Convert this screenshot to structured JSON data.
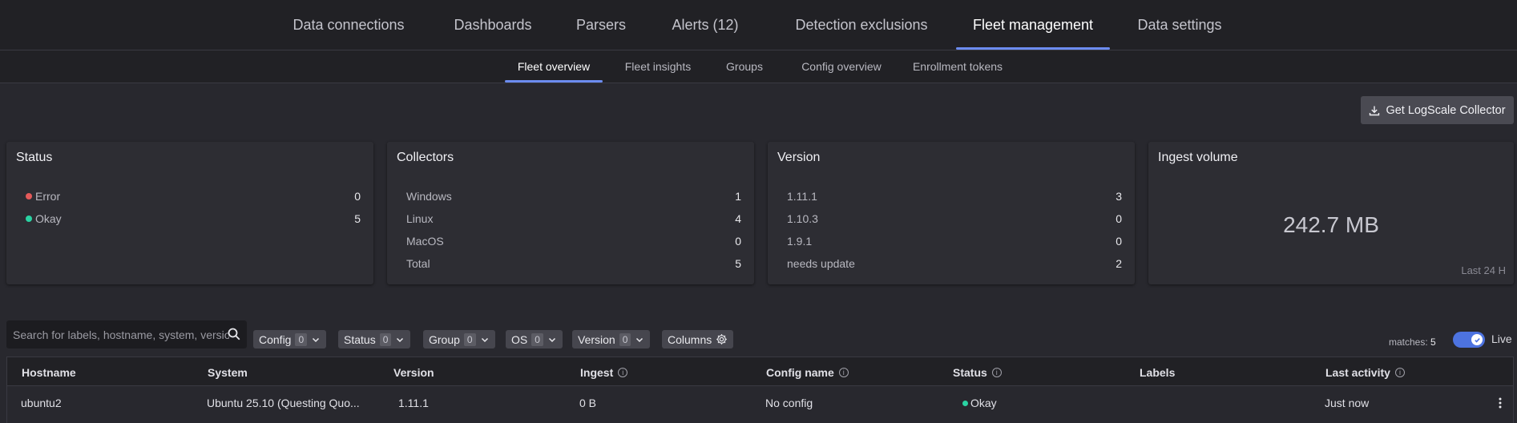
{
  "nav": {
    "tabs": [
      {
        "label": "Data connections"
      },
      {
        "label": "Dashboards"
      },
      {
        "label": "Parsers"
      },
      {
        "label": "Alerts (12)"
      },
      {
        "label": "Detection exclusions"
      },
      {
        "label": "Fleet management"
      },
      {
        "label": "Data settings"
      }
    ],
    "active": "Fleet management"
  },
  "subnav": {
    "tabs": [
      {
        "label": "Fleet overview"
      },
      {
        "label": "Fleet insights"
      },
      {
        "label": "Groups"
      },
      {
        "label": "Config overview"
      },
      {
        "label": "Enrollment tokens"
      }
    ],
    "active": "Fleet overview"
  },
  "get_collector_label": "Get LogScale Collector",
  "cards": {
    "status": {
      "title": "Status",
      "rows": [
        {
          "label": "Error",
          "value": "0",
          "color": "#e45a5a"
        },
        {
          "label": "Okay",
          "value": "5",
          "color": "#2ad3a3"
        }
      ]
    },
    "collectors": {
      "title": "Collectors",
      "rows": [
        {
          "label": "Windows",
          "value": "1"
        },
        {
          "label": "Linux",
          "value": "4"
        },
        {
          "label": "MacOS",
          "value": "0"
        },
        {
          "label": "Total",
          "value": "5"
        }
      ]
    },
    "version": {
      "title": "Version",
      "rows": [
        {
          "label": "1.11.1",
          "value": "3"
        },
        {
          "label": "1.10.3",
          "value": "0"
        },
        {
          "label": "1.9.1",
          "value": "0"
        },
        {
          "label": "needs update",
          "value": "2"
        }
      ]
    },
    "ingest": {
      "title": "Ingest volume",
      "value": "242.7 MB",
      "footer": "Last 24 H"
    }
  },
  "filters": {
    "search_placeholder": "Search for labels, hostname, system, version",
    "buttons": [
      {
        "label": "Config",
        "count": "0"
      },
      {
        "label": "Status",
        "count": "0"
      },
      {
        "label": "Group",
        "count": "0"
      },
      {
        "label": "OS",
        "count": "0"
      },
      {
        "label": "Version",
        "count": "0"
      }
    ],
    "columns_label": "Columns",
    "matches_label": "matches:",
    "matches_value": "5",
    "live_label": "Live"
  },
  "table": {
    "headers": [
      "Hostname",
      "System",
      "Version",
      "Ingest",
      "Config name",
      "Status",
      "Labels",
      "Last activity"
    ],
    "rows": [
      {
        "hostname": "ubuntu2",
        "system": "Ubuntu 25.10 (Questing Quo...",
        "version": "1.11.1",
        "ingest": "0 B",
        "config": "No config",
        "status": "Okay",
        "labels": "",
        "last_activity": "Just now"
      }
    ]
  },
  "colors": {
    "accent": "#6c8cf0",
    "ok": "#2ad3a3",
    "error": "#e45a5a",
    "toggle": "#4d73e0"
  }
}
